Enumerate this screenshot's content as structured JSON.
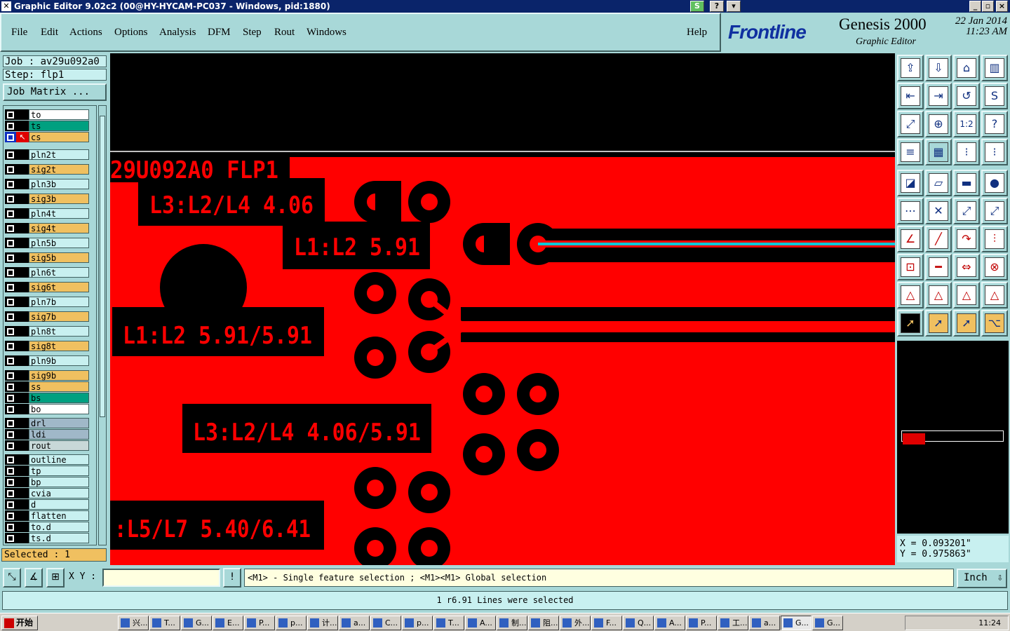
{
  "window": {
    "title": "Graphic Editor 9.02c2 (00@HY-HYCAM-PC037 - Windows, pid:1880)"
  },
  "menu": {
    "items": [
      "File",
      "Edit",
      "Actions",
      "Options",
      "Analysis",
      "DFM",
      "Step",
      "Rout",
      "Windows"
    ],
    "help": "Help"
  },
  "brand": {
    "logo": "Frontline",
    "product": "Genesis 2000",
    "subtitle": "Graphic Editor",
    "date": "22 Jan 2014",
    "time": "11:23 AM"
  },
  "job": {
    "job_label": "Job : av29u092a0",
    "step_label": "Step: flp1",
    "matrix_button": "Job Matrix ..."
  },
  "layers": [
    {
      "name": "to",
      "color": "#ffffff",
      "marker": ""
    },
    {
      "name": "ts",
      "color": "#00a080",
      "marker": ""
    },
    {
      "name": "cs",
      "color": "#f0c060",
      "marker": "active"
    },
    {
      "name": "pln2t",
      "color": "#c8f0f0",
      "marker": ""
    },
    {
      "name": "sig2t",
      "color": "#f0c060",
      "marker": ""
    },
    {
      "name": "pln3b",
      "color": "#c8f0f0",
      "marker": ""
    },
    {
      "name": "sig3b",
      "color": "#f0c060",
      "marker": ""
    },
    {
      "name": "pln4t",
      "color": "#c8f0f0",
      "marker": ""
    },
    {
      "name": "sig4t",
      "color": "#f0c060",
      "marker": ""
    },
    {
      "name": "pln5b",
      "color": "#c8f0f0",
      "marker": ""
    },
    {
      "name": "sig5b",
      "color": "#f0c060",
      "marker": ""
    },
    {
      "name": "pln6t",
      "color": "#c8f0f0",
      "marker": ""
    },
    {
      "name": "sig6t",
      "color": "#f0c060",
      "marker": ""
    },
    {
      "name": "pln7b",
      "color": "#c8f0f0",
      "marker": ""
    },
    {
      "name": "sig7b",
      "color": "#f0c060",
      "marker": ""
    },
    {
      "name": "pln8t",
      "color": "#c8f0f0",
      "marker": ""
    },
    {
      "name": "sig8t",
      "color": "#f0c060",
      "marker": ""
    },
    {
      "name": "pln9b",
      "color": "#c8f0f0",
      "marker": ""
    },
    {
      "name": "sig9b",
      "color": "#f0c060",
      "marker": ""
    },
    {
      "name": "ss",
      "color": "#f0c060",
      "marker": ""
    },
    {
      "name": "bs",
      "color": "#00a080",
      "marker": ""
    },
    {
      "name": "bo",
      "color": "#ffffff",
      "marker": ""
    },
    {
      "name": "drl",
      "color": "#a0b8c8",
      "marker": ""
    },
    {
      "name": "ldi",
      "color": "#a0b8c8",
      "marker": ""
    },
    {
      "name": "rout",
      "color": "#c8d8d8",
      "marker": ""
    },
    {
      "name": "outline",
      "color": "#c8f0f0",
      "marker": ""
    },
    {
      "name": "tp",
      "color": "#c8f0f0",
      "marker": ""
    },
    {
      "name": "bp",
      "color": "#c8f0f0",
      "marker": ""
    },
    {
      "name": "cvia",
      "color": "#c8f0f0",
      "marker": ""
    },
    {
      "name": "d",
      "color": "#c8f0f0",
      "marker": ""
    },
    {
      "name": "flatten",
      "color": "#c8f0f0",
      "marker": ""
    },
    {
      "name": "to.d",
      "color": "#c8f0f0",
      "marker": ""
    },
    {
      "name": "ts.d",
      "color": "#c8f0f0",
      "marker": ""
    }
  ],
  "selected": "Selected : 1",
  "canvas": {
    "labels": [
      "29U092A0 FLP1",
      "L3:L2/L4 4.06",
      "L1:L2 5.91",
      "L1:L2 5.91/5.91",
      "L3:L2/L4 4.06/5.91",
      ":L5/L7 5.40/6.41"
    ],
    "copper_color": "#ff0000",
    "selected_color": "#00c8d8"
  },
  "toolbox": {
    "icons": [
      "zoom-home-icon",
      "zoom-fit-icon",
      "home-icon",
      "window-split-icon",
      "pan-left-icon",
      "pan-right-icon",
      "rotate-icon",
      "snap-icon",
      "fit-icon",
      "center-icon",
      "ratio-icon",
      "help-icon",
      "layers-icon",
      "grid-icon",
      "feature-select-icon",
      "net-select-icon",
      "add-feature-icon",
      "edit-shape-icon",
      "measure-icon",
      "pad-icon",
      "connect-icon",
      "delete-icon",
      "move-icon",
      "copy-icon",
      "angle-line-icon",
      "draw-line-icon",
      "arc-icon",
      "text-icon",
      "snap-pad-icon",
      "line-break-icon",
      "resize-icon",
      "polarity-icon",
      "surface-a-icon",
      "surface-b-icon",
      "surface-c-icon",
      "surface-d-icon",
      "select-icon",
      "select-box-icon",
      "select-poly-icon",
      "select-net-icon"
    ],
    "ratio_label": "1:2",
    "help_label": "?"
  },
  "coords": {
    "x": "X = 0.093201\"",
    "y": "Y = 0.975863\""
  },
  "bottom": {
    "xy_label": "X Y :",
    "hint": "<M1> - Single feature selection ; <M1><M1> Global selection",
    "units": "Inch",
    "info": "!"
  },
  "status": "1 r6.91 Lines were selected",
  "taskbar": {
    "start": "开始",
    "tasks": [
      "兴...",
      "T...",
      "G...",
      "E...",
      "P...",
      "p...",
      "计...",
      "a...",
      "C...",
      "p...",
      "T...",
      "A...",
      "制...",
      "阻...",
      "外...",
      "F...",
      "Q...",
      "A...",
      "P...",
      "工...",
      "a...",
      "G...",
      "G..."
    ],
    "clock": "11:24"
  }
}
